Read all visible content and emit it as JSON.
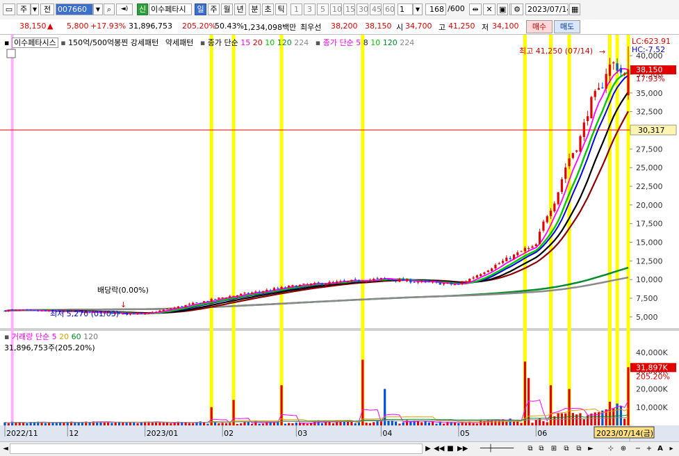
{
  "toolbar": {
    "market_label": "주",
    "prev_label": "전",
    "code": "007660",
    "shin_label": "신",
    "stock_name": "이수페타시",
    "periods": [
      "일",
      "주",
      "월",
      "년",
      "분",
      "초",
      "틱"
    ],
    "active_period": "일",
    "minutes": [
      "1",
      "3",
      "5",
      "10",
      "15",
      "30",
      "45",
      "60"
    ],
    "unit_value": "1",
    "count_display": "168",
    "count_total": "/600",
    "date": "2023/07/14"
  },
  "quote": {
    "price": "38,150",
    "arrow": "▲",
    "change": "5,800",
    "change_pct": "+17.93%",
    "volume": "31,896,753",
    "volume_ratio": "205.20%",
    "rate2": "50.43%",
    "amount": "1,234,098백만",
    "best_label": "최우선",
    "best_bid": "38,200",
    "best_ask": "38,150",
    "open_label": "시",
    "open": "34,700",
    "high_label": "고",
    "high": "41,250",
    "low_label": "저",
    "low": "34,100",
    "buy_label": "매수",
    "sell_label": "매도"
  },
  "price_legend": {
    "name": "이수페타시스",
    "pattern1": "150억/500억봉찐 강세패턴",
    "pattern2": "약세패턴",
    "ma_label": "종가 단순",
    "ma_periods": [
      "15",
      "20",
      "10",
      "120",
      "224"
    ],
    "ma2_label": "종가 단순",
    "ma2_periods": [
      "5",
      "8",
      "10",
      "120",
      "224"
    ]
  },
  "volume_legend": {
    "label": "거래량",
    "ma_label": "단순",
    "periods": [
      "5",
      "20",
      "60",
      "120"
    ],
    "value_line": "31,896,753주(205.20%)"
  },
  "annotations": {
    "high": "최고 41,250 (07/14)",
    "low": "최저 5,270 (01/03)",
    "dividend": "배당락(0.00%)",
    "lc": "LC:623.91",
    "hc": "HC:-7.52",
    "price_tag": "38,150",
    "pct_tag": "17.93%",
    "crosshair_tag": "30,317",
    "vol_tag": "31,897K",
    "vol_pct_tag": "205.20%",
    "date_tag": "2023/07/14(금)"
  },
  "price_axis": [
    "40,000",
    "37,500",
    "35,000",
    "32,500",
    "30,000",
    "27,500",
    "25,000",
    "22,500",
    "20,000",
    "17,500",
    "15,000",
    "12,500",
    "10,000",
    "7,500",
    "5,000"
  ],
  "volume_axis": [
    "40,000K",
    "30,000K",
    "20,000K",
    "10,000K"
  ],
  "x_axis": [
    "2022/11",
    "12",
    "2023/01",
    "02",
    "03",
    "04",
    "05",
    "06",
    "07"
  ],
  "colors": {
    "up": "#e00000",
    "down": "#0050d8",
    "highlight": "#ffff00",
    "pink": "#ffb0ff",
    "ma15": "#ff00ff",
    "ma20": "#00c800",
    "ma10": "#0000e0",
    "ma120": "#008c2a",
    "ma224": "#8a8a8a"
  },
  "chart_data": {
    "type": "candlestick",
    "symbol": "이수페타시스",
    "code": "007660",
    "last_close": 38150,
    "high": {
      "value": 41250,
      "date": "07/14"
    },
    "low": {
      "value": 5270,
      "date": "01/03"
    },
    "x": [
      "2022/11",
      "12",
      "2023/01",
      "02",
      "03",
      "04",
      "05",
      "06",
      "07"
    ],
    "close_profile": [
      {
        "label": "2022/11",
        "value": 5900
      },
      {
        "label": "12",
        "value": 5700
      },
      {
        "label": "2023/01",
        "value": 5400
      },
      {
        "label": "02",
        "value": 7600
      },
      {
        "label": "03",
        "value": 9200
      },
      {
        "label": "04",
        "value": 10100
      },
      {
        "label": "05",
        "value": 9300
      },
      {
        "label": "06",
        "value": 14800
      },
      {
        "label": "07",
        "value": 38150
      }
    ],
    "ylim": [
      3500,
      41500
    ],
    "volume_last": 31896753,
    "volume_ylim": [
      0,
      48000000
    ]
  }
}
